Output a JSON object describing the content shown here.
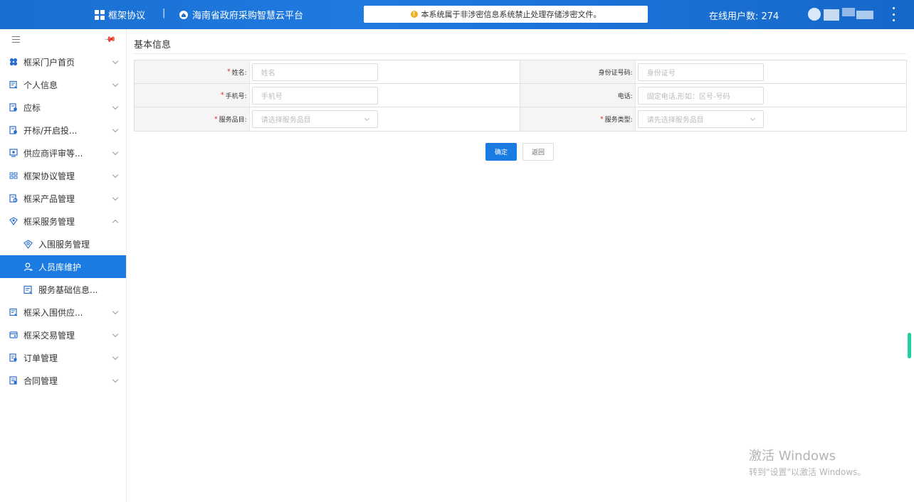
{
  "header": {
    "brand": "框架协议",
    "separator": "|",
    "platform": "海南省政府采购智慧云平台",
    "notice": "本系统属于非涉密信息系统禁止处理存储涉密文件。",
    "online_label": "在线用户数: 274",
    "colors": {
      "bar": "#1a6fd1",
      "accent": "#1a7be3",
      "required": "#e02020"
    }
  },
  "sidebar": {
    "items": [
      {
        "label": "框采门户首页",
        "icon": "clover-icon",
        "expanded": false
      },
      {
        "label": "个人信息",
        "icon": "id-card-icon",
        "expanded": false
      },
      {
        "label": "应标",
        "icon": "doc-gear-icon",
        "expanded": false
      },
      {
        "label": "开标/开启投...",
        "icon": "doc-gear-icon",
        "expanded": false
      },
      {
        "label": "供应商评审等...",
        "icon": "monitor-icon",
        "expanded": false
      },
      {
        "label": "框架协议管理",
        "icon": "contract-icon",
        "expanded": false
      },
      {
        "label": "框采产品管理",
        "icon": "doc-gear-icon",
        "expanded": false
      },
      {
        "label": "框采服务管理",
        "icon": "service-icon",
        "expanded": true
      }
    ],
    "sub_items": [
      {
        "label": "入围服务管理",
        "icon": "service-icon"
      },
      {
        "label": "人员库维护",
        "icon": "person-icon",
        "active": true
      },
      {
        "label": "服务基础信息...",
        "icon": "id-card-icon"
      }
    ],
    "items_after": [
      {
        "label": "框采入围供应...",
        "icon": "id-card-icon"
      },
      {
        "label": "框采交易管理",
        "icon": "wallet-icon"
      },
      {
        "label": "订单管理",
        "icon": "doc-gear-icon"
      },
      {
        "label": "合同管理",
        "icon": "doc-gear-icon"
      }
    ]
  },
  "main": {
    "section_title": "基本信息",
    "fields": {
      "name": {
        "label": "姓名:",
        "placeholder": "姓名",
        "required": true
      },
      "id_no": {
        "label": "身份证号码:",
        "placeholder": "身份证号",
        "required": false
      },
      "mobile": {
        "label": "手机号:",
        "placeholder": "手机号",
        "required": true
      },
      "phone": {
        "label": "电话:",
        "placeholder": "固定电话,形如：区号-号码",
        "required": false
      },
      "service_item": {
        "label": "服务品目:",
        "placeholder": "请选择服务品目",
        "required": true
      },
      "service_type": {
        "label": "服务类型:",
        "placeholder": "请先选择服务品目",
        "required": true
      }
    },
    "confirm_label": "确定",
    "back_label": "返回"
  },
  "watermark": {
    "line1": "激活 Windows",
    "line2": "转到\"设置\"以激活 Windows。"
  }
}
